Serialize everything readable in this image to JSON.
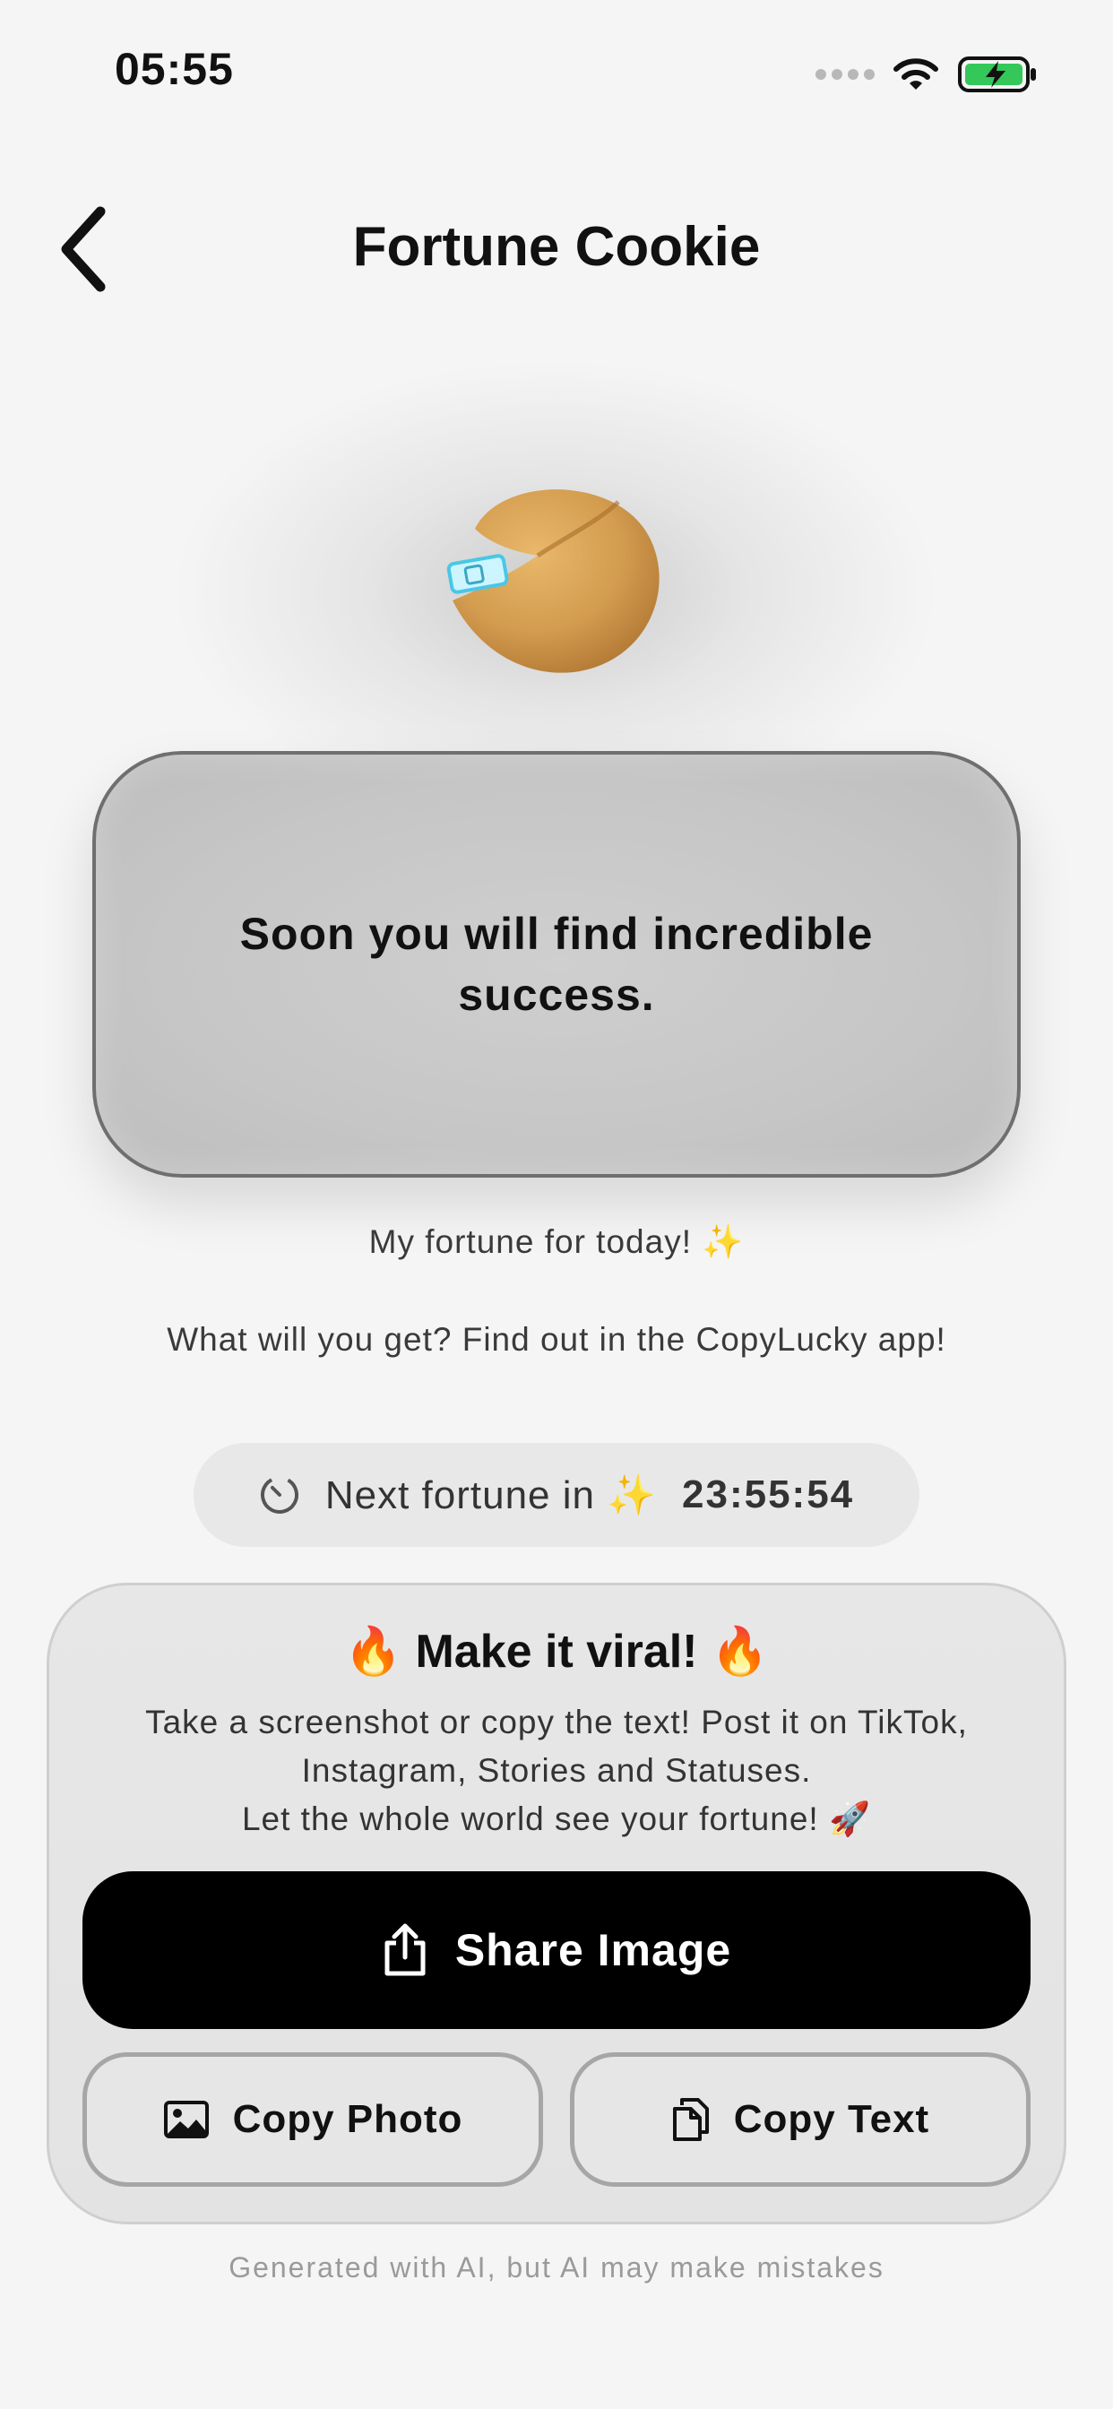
{
  "status_bar": {
    "time": "05:55"
  },
  "header": {
    "title": "Fortune Cookie",
    "back_icon": "chevron-left-icon"
  },
  "fortune": {
    "text": "Soon you will find incredible success."
  },
  "captions": {
    "line1": "My fortune for today! ✨",
    "line2": "What will you get? Find out in the CopyLucky app!"
  },
  "timer": {
    "label": "Next fortune in ✨",
    "value": "23:55:54",
    "icon": "timer-icon"
  },
  "viral": {
    "title": "🔥 Make it viral! 🔥",
    "line1": "Take a screenshot or copy the text! Post it on TikTok,",
    "line2": "Instagram, Stories and Statuses.",
    "line3": "Let the whole world see your fortune! 🚀"
  },
  "buttons": {
    "share_image": "Share Image",
    "copy_photo": "Copy Photo",
    "copy_text": "Copy Text"
  },
  "footer": {
    "note": "Generated with AI, but AI may make mistakes"
  },
  "colors": {
    "background": "#f5f5f5",
    "primary_button": "#000000",
    "battery_green": "#34c759"
  }
}
